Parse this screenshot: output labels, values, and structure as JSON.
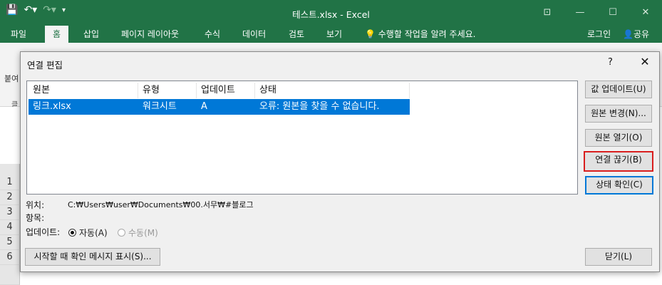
{
  "app": {
    "title": "테스트.xlsx - Excel",
    "qat": {
      "save_icon": "save-icon",
      "undo_icon": "undo-icon",
      "redo_icon": "redo-icon"
    },
    "window_controls": [
      "restore-ribbon-icon",
      "minimize-icon",
      "maximize-icon",
      "close-icon"
    ]
  },
  "ribbon_tabs": [
    {
      "label": "파일"
    },
    {
      "label": "홈"
    },
    {
      "label": "삽입"
    },
    {
      "label": "페이지 레이아웃"
    },
    {
      "label": "수식"
    },
    {
      "label": "데이터"
    },
    {
      "label": "검토"
    },
    {
      "label": "보기"
    }
  ],
  "tell_me": "수행할 작업을 알려 주세요.",
  "sign_in": "로그인",
  "share": "공유",
  "ribbon": {
    "paste_label": "붙여",
    "clipboard_label": "클"
  },
  "rows": [
    "1",
    "2",
    "3",
    "4",
    "5",
    "6"
  ],
  "dialog": {
    "title": "연결 편집",
    "help": "?",
    "close": "✕",
    "columns": [
      "원본",
      "유형",
      "업데이트",
      "상태"
    ],
    "links": [
      {
        "source": "링크.xlsx",
        "type": "워크시트",
        "update": "A",
        "status": "오류: 원본을 찾을 수 없습니다."
      }
    ],
    "buttons": {
      "update_values": "값 업데이트(U)",
      "change_source": "원본 변경(N)...",
      "open_source": "원본 열기(O)",
      "break_link": "연결 끊기(B)",
      "check_status": "상태 확인(C)",
      "startup_prompt": "시작할 때 확인 메시지 표시(S)...",
      "close": "닫기(L)"
    },
    "location_label": "위치:",
    "location_value": "C:₩Users₩user₩Documents₩00.서무₩#블로그",
    "item_label": "항목:",
    "update_label": "업데이트:",
    "update_options": [
      {
        "label": "자동(A)",
        "selected": true,
        "enabled": true
      },
      {
        "label": "수동(M)",
        "selected": false,
        "enabled": false
      }
    ]
  }
}
